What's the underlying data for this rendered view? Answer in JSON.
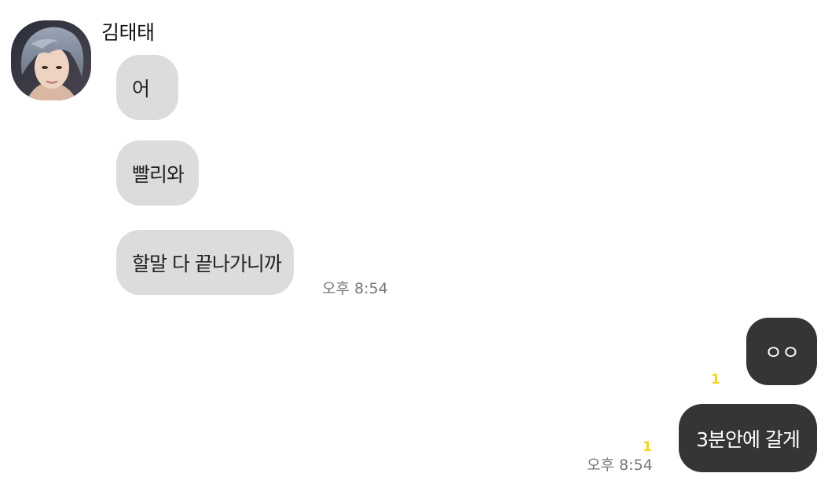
{
  "chat": {
    "sender": {
      "name": "김태태",
      "avatar_icon": "profile-photo"
    },
    "incoming": [
      {
        "text": "어"
      },
      {
        "text": "빨리와"
      },
      {
        "text": "할말 다 끝나가니까"
      }
    ],
    "incoming_time": "오후 8:54",
    "outgoing": [
      {
        "text": "ㅇㅇ",
        "unread": "1"
      },
      {
        "text": "3분안에 갈게",
        "unread": "1"
      }
    ],
    "outgoing_time": "오후 8:54"
  },
  "colors": {
    "incoming_bubble": "#dcdcdc",
    "outgoing_bubble": "#353535",
    "unread_count": "#f2d31d",
    "timestamp": "#777777"
  }
}
